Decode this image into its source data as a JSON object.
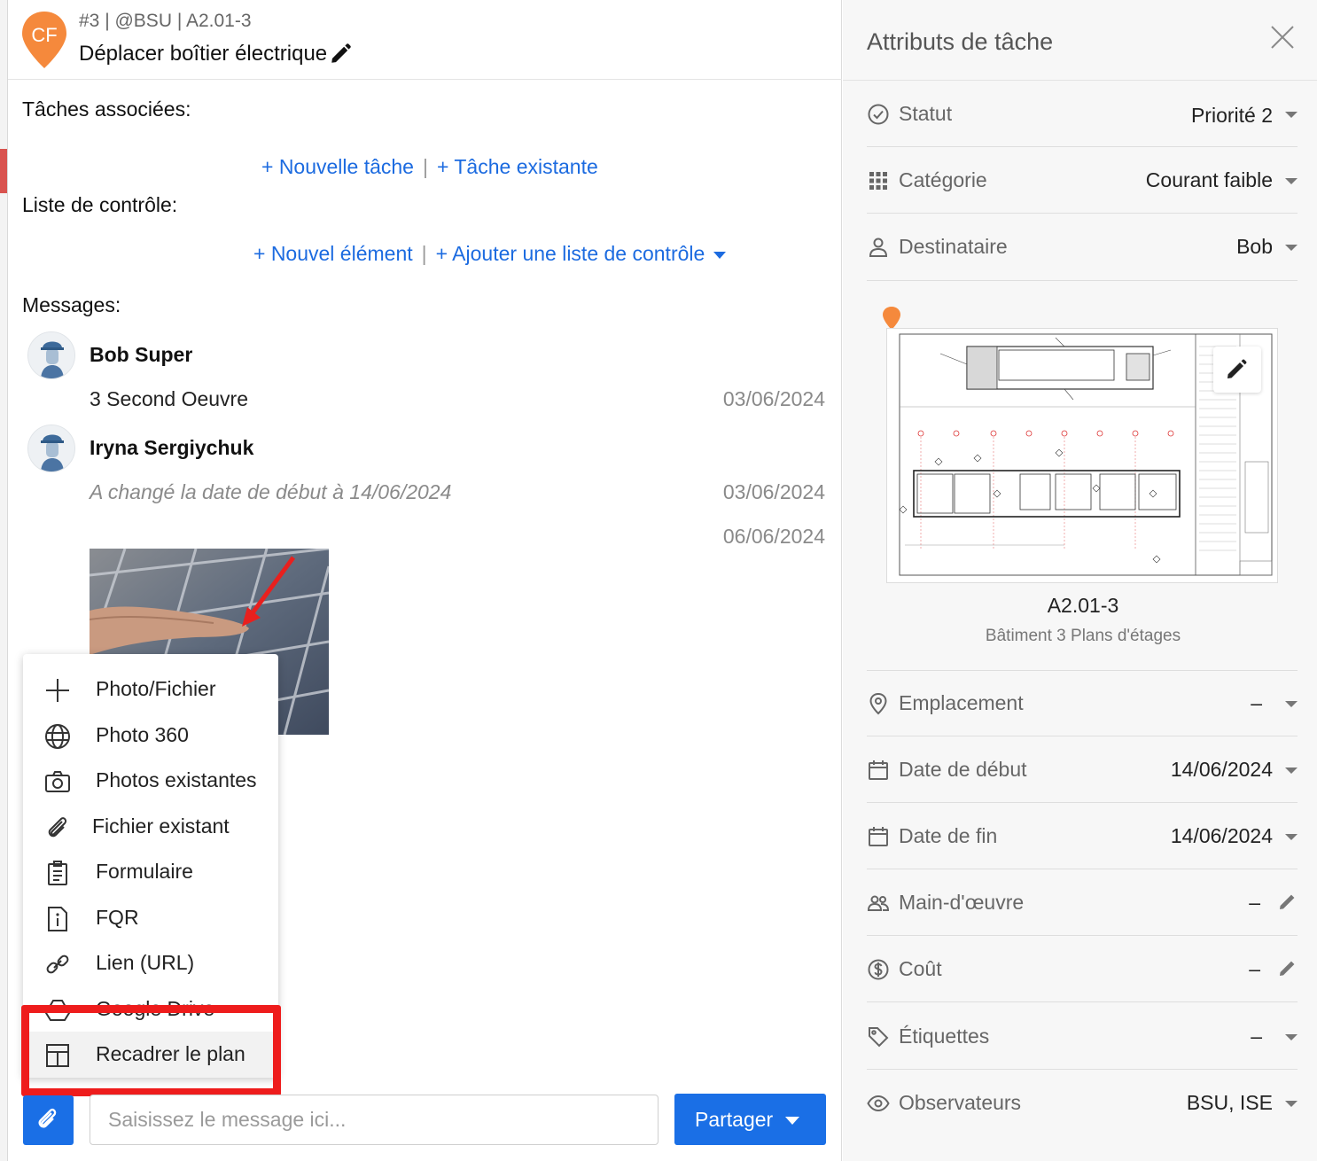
{
  "task": {
    "avatar_initials": "CF",
    "meta": "#3 | @BSU | A2.01-3",
    "title": "Déplacer boîtier électrique"
  },
  "related_tasks": {
    "label": "Tâches associées:",
    "new_task": "+ Nouvelle tâche",
    "existing_task": "+ Tâche existante",
    "separator": "|"
  },
  "checklist": {
    "label": "Liste de contrôle:",
    "new_item": "+ Nouvel élément",
    "add_checklist": "+ Ajouter une liste de contrôle",
    "separator": "|"
  },
  "messages": {
    "label": "Messages:",
    "items": [
      {
        "author": "Bob Super",
        "text": "3 Second Oeuvre",
        "date": "03/06/2024"
      },
      {
        "author": "Iryna Sergiychuk",
        "text": "A changé la date de début à 14/06/2024",
        "date": "03/06/2024"
      },
      {
        "author": "",
        "text": "",
        "date": "06/06/2024"
      }
    ]
  },
  "attach_menu": {
    "items": [
      {
        "label": "Photo/Fichier",
        "icon": "plus-icon"
      },
      {
        "label": "Photo 360",
        "icon": "globe-icon"
      },
      {
        "label": "Photos existantes",
        "icon": "camera-icon"
      },
      {
        "label": "Fichier existant",
        "icon": "paperclip-icon"
      },
      {
        "label": "Formulaire",
        "icon": "clipboard-icon"
      },
      {
        "label": "FQR",
        "icon": "info-document-icon"
      },
      {
        "label": "Lien (URL)",
        "icon": "link-icon"
      },
      {
        "label": "Google Drive",
        "icon": "google-drive-icon"
      },
      {
        "label": "Recadrer le plan",
        "icon": "crop-plan-icon"
      }
    ]
  },
  "composer": {
    "placeholder": "Saisissez le message ici...",
    "share_label": "Partager"
  },
  "attributes": {
    "title": "Attributs de tâche",
    "status": {
      "label": "Statut",
      "value": "Priorité 2"
    },
    "category": {
      "label": "Catégorie",
      "value": "Courant faible"
    },
    "assignee": {
      "label": "Destinataire",
      "value": "Bob"
    },
    "plan": {
      "name": "A2.01-3",
      "subtitle": "Bâtiment 3 Plans d'étages"
    },
    "location": {
      "label": "Emplacement",
      "value": "–"
    },
    "start_date": {
      "label": "Date de début",
      "value": "14/06/2024"
    },
    "end_date": {
      "label": "Date de fin",
      "value": "14/06/2024"
    },
    "manpower": {
      "label": "Main-d'œuvre",
      "value": "–"
    },
    "cost": {
      "label": "Coût",
      "value": "–"
    },
    "tags": {
      "label": "Étiquettes",
      "value": "–"
    },
    "watchers": {
      "label": "Observateurs",
      "value": "BSU, ISE"
    }
  },
  "colors": {
    "accent": "#1a6fe6",
    "link": "#1c6be0",
    "pin": "#f5893c",
    "highlight": "#ee1c1c"
  }
}
